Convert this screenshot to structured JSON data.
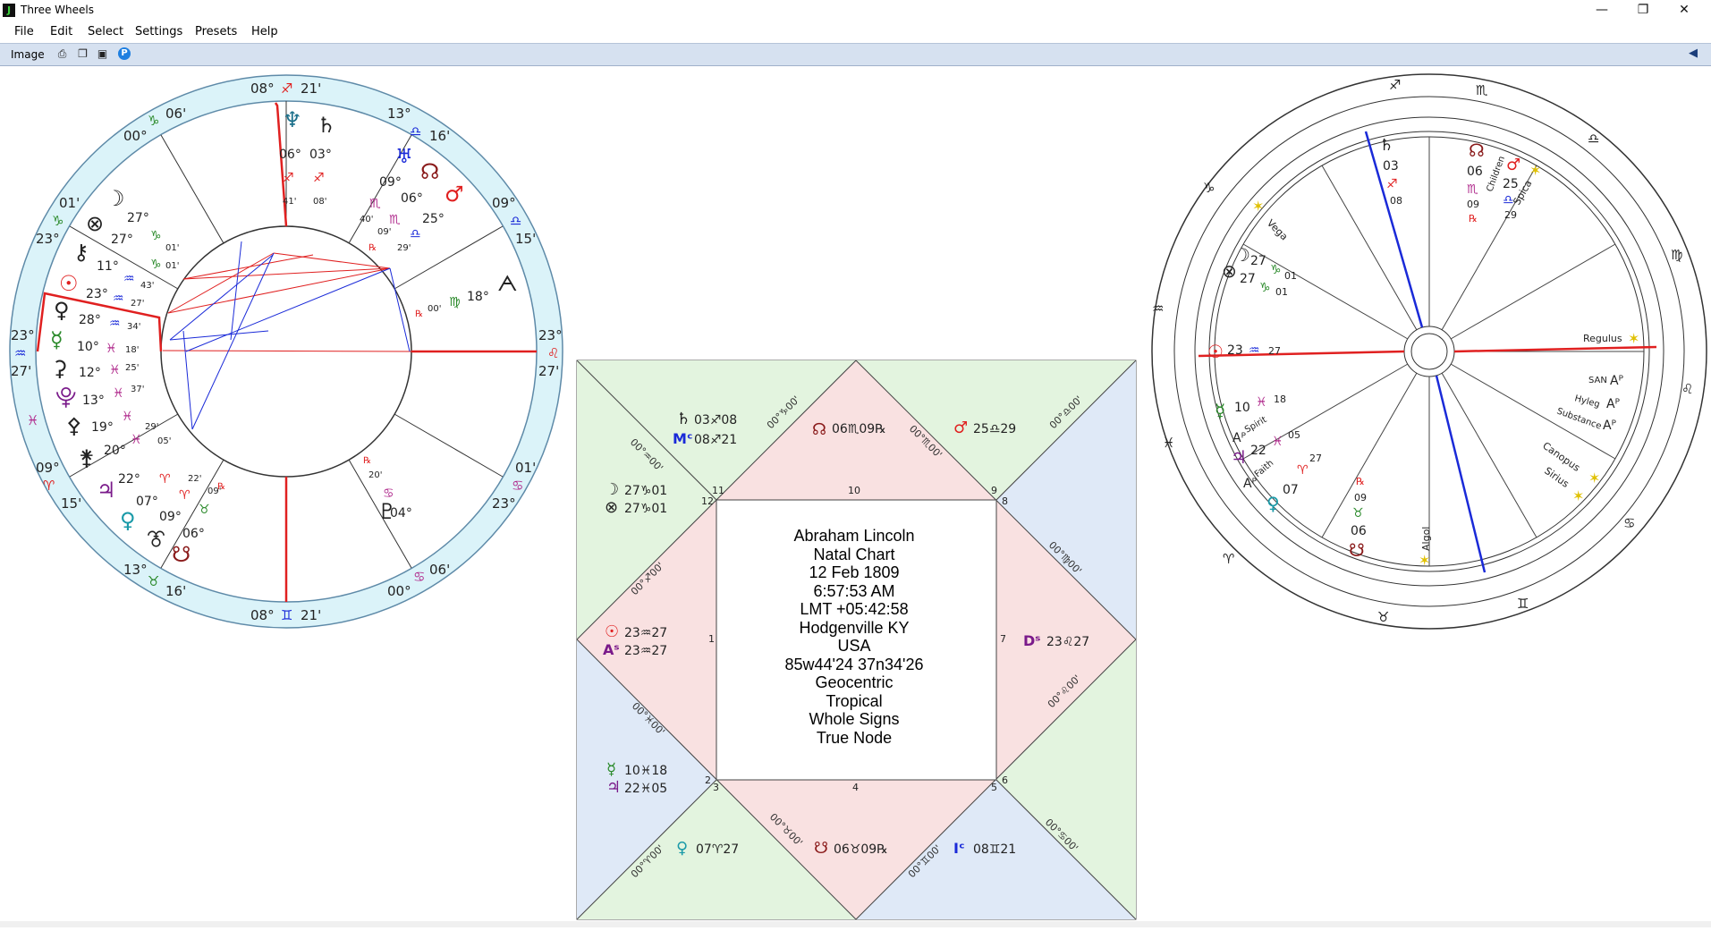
{
  "window": {
    "title": "Three Wheels",
    "minimize_glyph": "—",
    "restore_glyph": "❐",
    "close_glyph": "✕"
  },
  "menu": [
    "File",
    "Edit",
    "Select",
    "Settings",
    "Presets",
    "Help"
  ],
  "toolbar": {
    "image_label": "Image",
    "print_icon": "printer-icon",
    "copy_icon": "copy-icon",
    "save_icon": "save-icon",
    "help_icon": "P",
    "collapse": "◀"
  },
  "colors": {
    "ring_fill": "#dbf3f9",
    "ring_stroke": "#5e8aa8",
    "axis_red": "#e02020",
    "mc_blue": "#1a2ad8",
    "square_blue": "#dfe9f7",
    "square_green": "#e3f4df",
    "square_red": "#f9e1e1"
  },
  "left_wheel": {
    "ring_labels": [
      {
        "t": "08°",
        "g": "♐",
        "g2": "21'",
        "cusp": "MC"
      },
      {
        "t": "13°",
        "t2": "16'",
        "g": "♎"
      },
      {
        "t": "09°",
        "t2": "15'",
        "g": "♎"
      },
      {
        "t": "23°",
        "t2": "27'",
        "g": "♌"
      },
      {
        "t": "01'",
        "t2": "23°",
        "g": "♋"
      },
      {
        "t": "06'",
        "t2": "00°",
        "g": "♋"
      },
      {
        "t": "08°",
        "g": "♊",
        "g2": "21'",
        "cusp": "IC"
      },
      {
        "t": "13°",
        "t2": "16'",
        "g": "♉"
      },
      {
        "t": "09°",
        "t2": "15'",
        "g": "♈"
      },
      {
        "t": "23°",
        "t2": "27'",
        "g": "♒"
      },
      {
        "t": "01'",
        "t2": "23°",
        "g": "♑"
      },
      {
        "t": "06'",
        "t2": "00°",
        "g": "♑"
      }
    ],
    "planets": [
      {
        "g": "♆",
        "deg": "06°",
        "sign": "♐",
        "min": "41'"
      },
      {
        "g": "♄",
        "deg": "03°",
        "sign": "♐",
        "min": "08'"
      },
      {
        "g": "♅",
        "deg": "09°",
        "sign": "♏",
        "min": "40'"
      },
      {
        "g": "☊",
        "deg": "06°",
        "sign": "♏",
        "min": "09'"
      },
      {
        "g": "♂",
        "deg": "25°",
        "sign": "♎",
        "min": "29'"
      },
      {
        "g": "ᗅ",
        "deg": "18°",
        "sign": "♍",
        "min": "00'"
      },
      {
        "g": "☽",
        "deg": "27°",
        "sign": "♑",
        "min": "01'"
      },
      {
        "g": "⊗",
        "deg": "27°",
        "sign": "♑",
        "min": "01'"
      },
      {
        "g": "⚷",
        "deg": "11°",
        "sign": "♒",
        "min": "43'"
      },
      {
        "g": "☉",
        "deg": "23°",
        "sign": "♒",
        "min": "27'"
      },
      {
        "g": "♀",
        "deg": "28°",
        "sign": "♒",
        "min": "34'"
      },
      {
        "g": "☿",
        "deg": "10°",
        "sign": "♓",
        "min": "18'"
      },
      {
        "g": "⚳",
        "deg": "12°",
        "sign": "♓",
        "min": "25'"
      },
      {
        "g": "⯓",
        "deg": "13°",
        "sign": "♓",
        "min": "37'"
      },
      {
        "g": "⚴",
        "deg": "19°",
        "sign": "♓",
        "min": "29'"
      },
      {
        "g": "⚵",
        "deg": "20°",
        "sign": "♓",
        "min": "05'"
      },
      {
        "g": "♃",
        "deg": "22°",
        "sign": "♈",
        "min": "22'"
      },
      {
        "g": "⚶",
        "deg": "07°",
        "sign": "♈",
        "min": "09'"
      },
      {
        "g": "♀",
        "deg": "09°",
        "sign": "♉",
        "min": "06'"
      },
      {
        "g": "☋",
        "deg": "06°",
        "sign": "♉",
        "min": "09'"
      },
      {
        "g": "♇",
        "deg": "04°",
        "sign": "♋",
        "min": "20'"
      }
    ],
    "retro": "℞"
  },
  "square": {
    "title_lines": [
      "Abraham Lincoln",
      "Natal Chart",
      "12 Feb 1809",
      "6:57:53 AM",
      "LMT +05:42:58",
      "Hodgenville KY",
      "USA",
      "85w44'24 37n34'26",
      "Geocentric",
      "Tropical",
      "Whole Signs",
      "True Node"
    ],
    "house_numbers": [
      "1",
      "2",
      "3",
      "4",
      "5",
      "6",
      "7",
      "8",
      "9",
      "10",
      "11",
      "12"
    ],
    "cusps": [
      "00°♑00'",
      "00°♐00'",
      "00°♏00'",
      "00°♎00'",
      "00°♍00'",
      "00°♌00'",
      "00°♋00'",
      "00°♊00'",
      "00°♉00'",
      "00°♈00'",
      "00°♓00'",
      "00°♒00'"
    ],
    "h10": "06♏09℞",
    "h9": "25♎29",
    "h11_a": "03♐08",
    "h11_b": "08♐21",
    "h12_a": "27♑01",
    "h12_b": "27♑01",
    "h1_a": "23♒27",
    "h1_b": "23♒27",
    "h2_a": "10♓18",
    "h2_b": "22♓05",
    "h3": "07♈27",
    "h4": "06♉09℞",
    "h5": "08♊21",
    "h7": "23♌27"
  },
  "right_wheel": {
    "labels": [
      {
        "g": "♄",
        "v": "03",
        "v2": "08"
      },
      {
        "g": "☊",
        "v": "06",
        "v2": "09"
      },
      {
        "g": "♂",
        "v": "25",
        "v2": "29"
      },
      {
        "g": "☽",
        "v": "27",
        "v2": "01"
      },
      {
        "g": "⊗",
        "v": "27",
        "v2": "01"
      },
      {
        "g": "☉",
        "v": "23",
        "v2": "27"
      },
      {
        "g": "☿",
        "v": "10",
        "v2": "18"
      },
      {
        "g": "♃",
        "v": "22",
        "v2": "05"
      },
      {
        "g": "♀",
        "v": "07",
        "v2": "27"
      },
      {
        "g": "☋",
        "v": "06",
        "v2": "09"
      }
    ],
    "stars": [
      "Vega",
      "Spica",
      "Regulus",
      "Canopus",
      "Sirius",
      "Algol"
    ],
    "parts": [
      "Children",
      "Spirit",
      "Faith",
      "SAN",
      "Hyleg",
      "Substance"
    ]
  }
}
